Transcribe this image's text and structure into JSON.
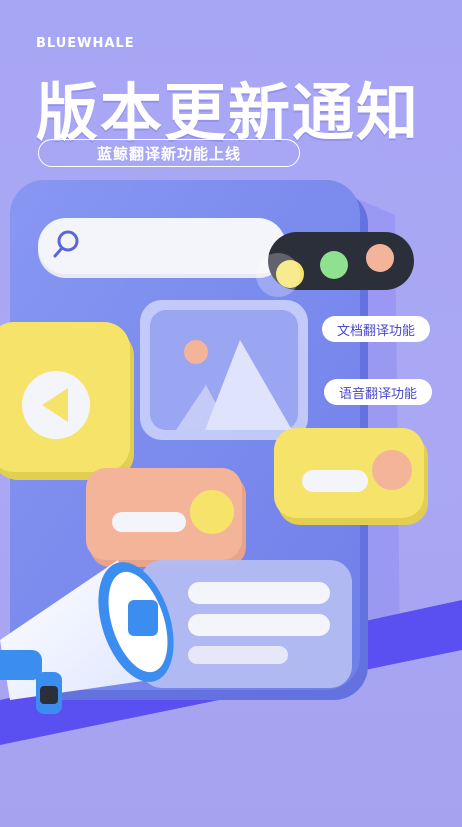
{
  "brand": "BLUEWHALE",
  "title": "版本更新通知",
  "subtitle": "蓝鲸翻译新功能上线",
  "features": [
    "文档翻译功能",
    "语音翻译功能"
  ],
  "icons": [
    "search-icon",
    "image-icon",
    "play-icon",
    "megaphone-icon"
  ],
  "colors": {
    "background": "#a9a7f4",
    "phone": "#7b8bef",
    "yellow": "#f5e36a",
    "peach": "#f4b49a",
    "green": "#8fe08f",
    "dark": "#2b2f3a",
    "blue_band": "#5a4ff0"
  }
}
